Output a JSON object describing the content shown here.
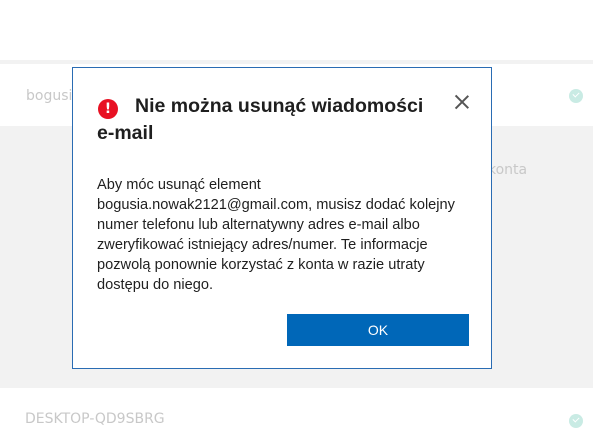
{
  "background": {
    "account_label": "bogusia",
    "side_text": "konta",
    "device_name": "DESKTOP-QD9SBRG"
  },
  "dialog": {
    "title": "Nie można usunąć wiadomości e-mail",
    "message": "Aby móc usunąć element bogusia.nowak2121@gmail.com, musisz dodać kolejny numer telefonu lub alternatywny adres e-mail albo zweryfikować istniejący adres/numer. Te informacje pozwolą ponownie korzystać z konta w razie utraty dostępu do niego.",
    "ok_label": "OK",
    "error_icon_glyph": "!"
  },
  "colors": {
    "accent": "#0067b8",
    "error": "#e81123",
    "dialog_border": "#2a6cb3"
  },
  "icons": {
    "error": "error-icon",
    "close": "close-icon",
    "verified": "check-circle-icon"
  }
}
